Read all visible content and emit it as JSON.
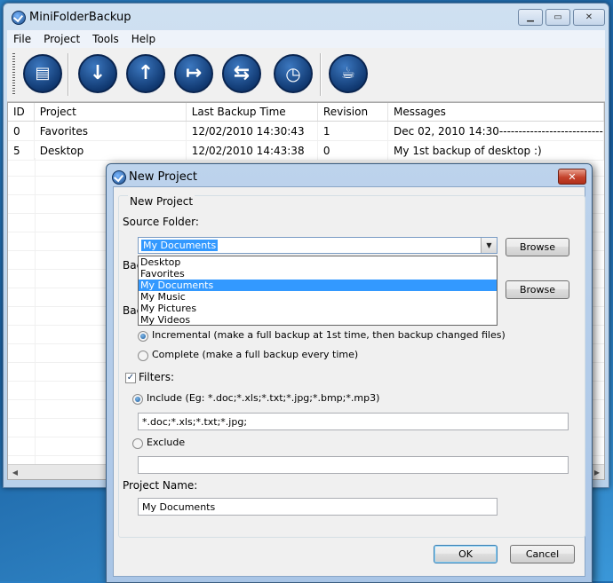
{
  "main_window": {
    "title": "MiniFolderBackup",
    "menu": [
      "File",
      "Project",
      "Tools",
      "Help"
    ],
    "toolbar_icons": [
      "new-project-icon",
      "backup-down-icon",
      "restore-up-icon",
      "export-icon",
      "sync-icon",
      "schedule-icon",
      "coffee-icon"
    ],
    "grid": {
      "columns": [
        "ID",
        "Project",
        "Last Backup Time",
        "Revision",
        "Messages"
      ],
      "rows": [
        [
          "0",
          "Favorites",
          "12/02/2010  14:30:43",
          "1",
          "Dec 02, 2010 14:30-----------------------------"
        ],
        [
          "5",
          "Desktop",
          "12/02/2010  14:43:38",
          "0",
          "My 1st backup of desktop :)"
        ]
      ]
    }
  },
  "dialog": {
    "title": "New Project",
    "group_label": "New Project",
    "source_folder_label": "Source Folder:",
    "source_selected": "My Documents",
    "source_options": [
      "Desktop",
      "Favorites",
      "My Documents",
      "My Music",
      "My Pictures",
      "My Videos"
    ],
    "backup_folder_label_partial": "Bac",
    "backup_type_label_partial": "Bac",
    "browse_label": "Browse",
    "incremental_label": "Incremental (make a full backup at 1st time, then backup changed files)",
    "complete_label": "Complete (make a full backup every time)",
    "filters_label": "Filters:",
    "include_label": "Include  (Eg: *.doc;*.xls;*.txt;*.jpg;*.bmp;*.mp3)",
    "include_value": "*.doc;*.xls;*.txt;*.jpg;",
    "exclude_label": "Exclude",
    "exclude_value": "",
    "project_name_label": "Project Name:",
    "project_name_value": "My Documents",
    "ok_label": "OK",
    "cancel_label": "Cancel",
    "close_glyph": "✕"
  }
}
